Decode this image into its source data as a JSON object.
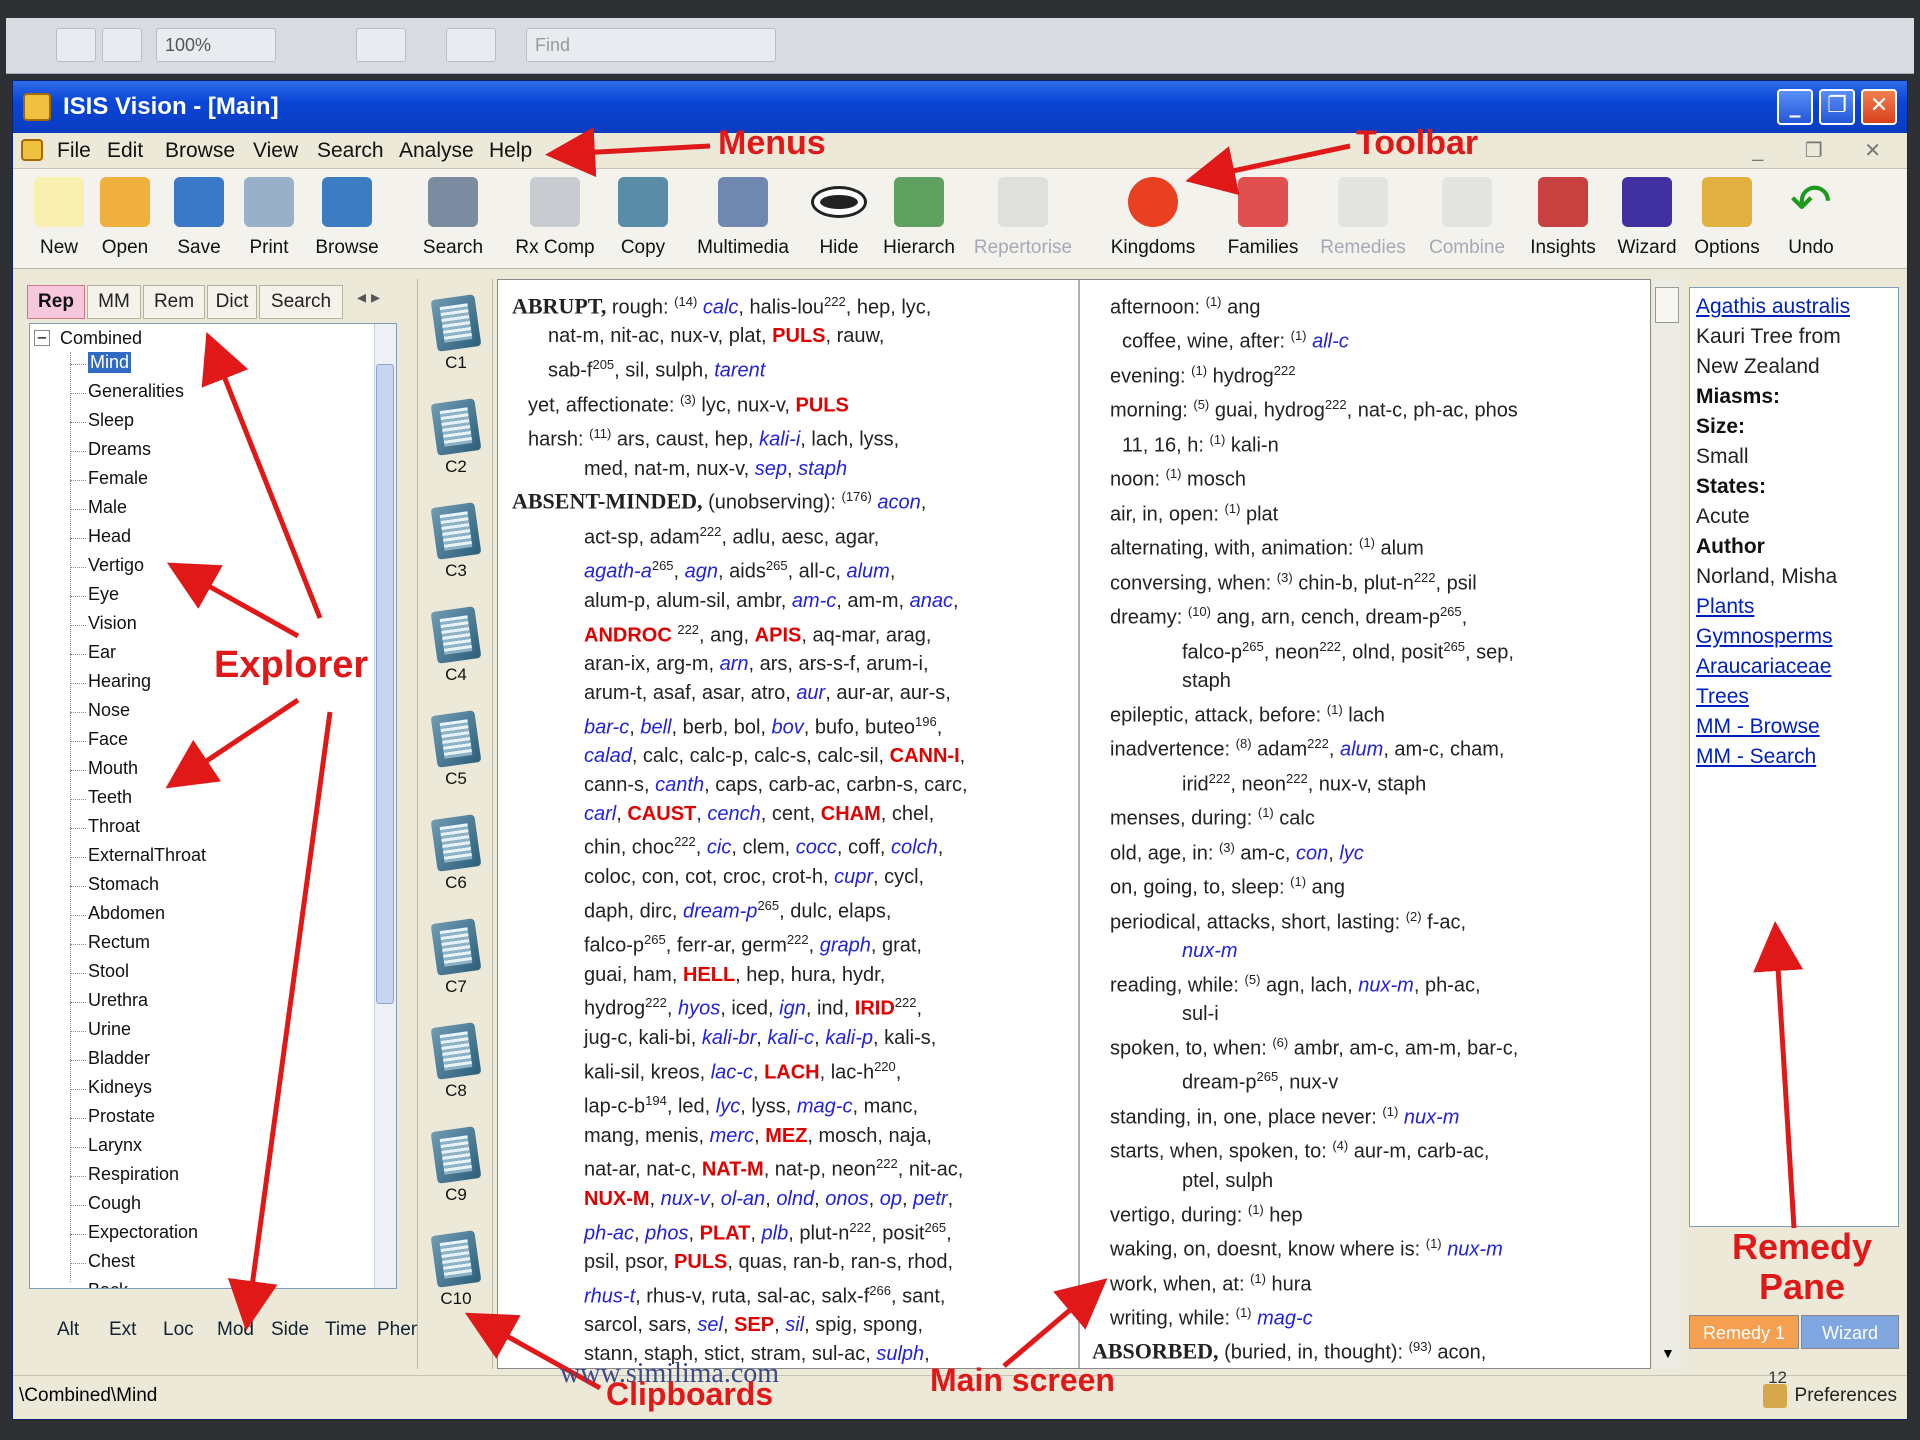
{
  "outer_toolbar": {
    "zoom_value": "100%",
    "find_placeholder": "Find"
  },
  "window": {
    "title": "ISIS Vision - [Main]",
    "min": "_",
    "max": "❐",
    "close": "✕"
  },
  "menu": {
    "items": [
      "File",
      "Edit",
      "Browse",
      "View",
      "Search",
      "Analyse",
      "Help"
    ],
    "mdi_controls": "_ ❐ ✕"
  },
  "toolbar": {
    "items": [
      {
        "label": "New",
        "icon": "new-document-icon",
        "enabled": true
      },
      {
        "label": "Open",
        "icon": "folder-icon",
        "enabled": true
      },
      {
        "label": "Save",
        "icon": "floppy-disk-icon",
        "enabled": true
      },
      {
        "label": "Print",
        "icon": "printer-icon",
        "enabled": true
      },
      {
        "label": "Browse",
        "icon": "book-icon",
        "enabled": true
      },
      {
        "label": "Search",
        "icon": "magnifier-icon",
        "enabled": true
      },
      {
        "label": "Rx Comp",
        "icon": "jar-icon",
        "enabled": true
      },
      {
        "label": "Copy",
        "icon": "clipboard-icon",
        "enabled": true
      },
      {
        "label": "Multimedia",
        "icon": "multimedia-icon",
        "enabled": true
      },
      {
        "label": "Hide",
        "icon": "eye-icon",
        "enabled": true
      },
      {
        "label": "Hierarch",
        "icon": "hierarchy-icon",
        "enabled": true
      },
      {
        "label": "Repertorise",
        "icon": "repertorise-icon",
        "enabled": false
      },
      {
        "label": "Kingdoms",
        "icon": "pie-chart-icon",
        "enabled": true
      },
      {
        "label": "Families",
        "icon": "people-icon",
        "enabled": true
      },
      {
        "label": "Remedies",
        "icon": "hand-icon",
        "enabled": false
      },
      {
        "label": "Combine",
        "icon": "combine-icon",
        "enabled": false
      },
      {
        "label": "Insights",
        "icon": "insights-icon",
        "enabled": true
      },
      {
        "label": "Wizard",
        "icon": "wizard-hat-icon",
        "enabled": true
      },
      {
        "label": "Options",
        "icon": "options-icon",
        "enabled": true
      },
      {
        "label": "Undo",
        "icon": "undo-arrow-icon",
        "enabled": true
      }
    ]
  },
  "explorer": {
    "tabs": [
      "Rep",
      "MM",
      "Rem",
      "Dict",
      "Search"
    ],
    "active_tab": "Rep",
    "root": "Combined",
    "nodes": [
      "Mind",
      "Generalities",
      "Sleep",
      "Dreams",
      "Female",
      "Male",
      "Head",
      "Vertigo",
      "Eye",
      "Vision",
      "Ear",
      "Hearing",
      "Nose",
      "Face",
      "Mouth",
      "Teeth",
      "Throat",
      "ExternalThroat",
      "Stomach",
      "Abdomen",
      "Rectum",
      "Stool",
      "Urethra",
      "Urine",
      "Bladder",
      "Kidneys",
      "Prostate",
      "Larynx",
      "Respiration",
      "Cough",
      "Expectoration",
      "Chest",
      "Back"
    ],
    "selected": "Mind",
    "bottom_tabs": [
      "Alt",
      "Ext",
      "Loc",
      "Mod",
      "Side",
      "Time",
      "Phen"
    ]
  },
  "clipboards": [
    "C1",
    "C2",
    "C3",
    "C4",
    "C5",
    "C6",
    "C7",
    "C8",
    "C9",
    "C10"
  ],
  "remedy_pane": {
    "title": "Agathis australis",
    "common": [
      "Kauri Tree from",
      "New Zealand"
    ],
    "fields": [
      {
        "label": "Miasms:",
        "value": ""
      },
      {
        "label": "Size:",
        "value": "Small"
      },
      {
        "label": "States:",
        "value": "Acute"
      },
      {
        "label": "Author",
        "value": "Norland, Misha"
      }
    ],
    "links": [
      "Plants",
      "Gymnosperms",
      "Araucariaceae",
      "Trees",
      "MM - Browse",
      "MM - Search"
    ],
    "tabs": [
      "Remedy 1",
      "Wizard"
    ],
    "page_number": "12"
  },
  "status": {
    "path": "\\Combined\\Mind",
    "preferences": "Preferences"
  },
  "annotations": {
    "menus": "Menus",
    "toolbar": "Toolbar",
    "explorer": "Explorer",
    "remedy_pane_1": "Remedy",
    "remedy_pane_2": "Pane",
    "clipboards": "Clipboards",
    "main_screen": "Main screen",
    "watermark": "www.similima.com"
  },
  "colors": {
    "title_blue": "#0a46d6",
    "rubric_red": "#e00000",
    "remedy_blue": "#2222dd",
    "annotation_red": "#e01818",
    "active_tab_pink": "#f7c7de"
  }
}
